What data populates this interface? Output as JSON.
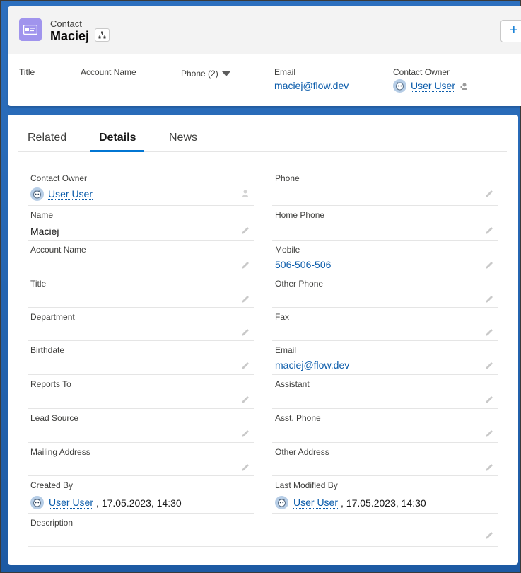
{
  "header": {
    "record_type": "Contact",
    "record_name": "Maciej",
    "plus_label": "+",
    "highlights": {
      "title_label": "Title",
      "account_label": "Account Name",
      "phone_label": "Phone (2)",
      "email_label": "Email",
      "email_value": "maciej@flow.dev",
      "owner_label": "Contact Owner",
      "owner_value": "User User"
    }
  },
  "tabs": [
    {
      "label": "Related",
      "active": false
    },
    {
      "label": "Details",
      "active": true
    },
    {
      "label": "News",
      "active": false
    }
  ],
  "fields": {
    "contact_owner": {
      "label": "Contact Owner",
      "value": "User User"
    },
    "phone": {
      "label": "Phone",
      "value": ""
    },
    "name": {
      "label": "Name",
      "value": "Maciej"
    },
    "home_phone": {
      "label": "Home Phone",
      "value": ""
    },
    "account_name": {
      "label": "Account Name",
      "value": ""
    },
    "mobile": {
      "label": "Mobile",
      "value": "506-506-506"
    },
    "title": {
      "label": "Title",
      "value": ""
    },
    "other_phone": {
      "label": "Other Phone",
      "value": ""
    },
    "department": {
      "label": "Department",
      "value": ""
    },
    "fax": {
      "label": "Fax",
      "value": ""
    },
    "birthdate": {
      "label": "Birthdate",
      "value": ""
    },
    "email": {
      "label": "Email",
      "value": "maciej@flow.dev"
    },
    "reports_to": {
      "label": "Reports To",
      "value": ""
    },
    "assistant": {
      "label": "Assistant",
      "value": ""
    },
    "lead_source": {
      "label": "Lead Source",
      "value": ""
    },
    "asst_phone": {
      "label": "Asst. Phone",
      "value": ""
    },
    "mailing_address": {
      "label": "Mailing Address",
      "value": ""
    },
    "other_address": {
      "label": "Other Address",
      "value": ""
    },
    "created_by": {
      "label": "Created By",
      "user": "User User",
      "date": ", 17.05.2023, 14:30"
    },
    "last_modified_by": {
      "label": "Last Modified By",
      "user": "User User",
      "date": ", 17.05.2023, 14:30"
    },
    "description": {
      "label": "Description",
      "value": ""
    }
  },
  "colors": {
    "brand": "#0176d3",
    "link": "#0b5cab",
    "contact_icon": "#a094ed",
    "background": "#1f5fa8"
  },
  "icons": [
    "contact-card-icon",
    "hierarchy-icon",
    "caret-down-icon",
    "avatar-icon",
    "change-owner-icon",
    "pencil-icon"
  ]
}
